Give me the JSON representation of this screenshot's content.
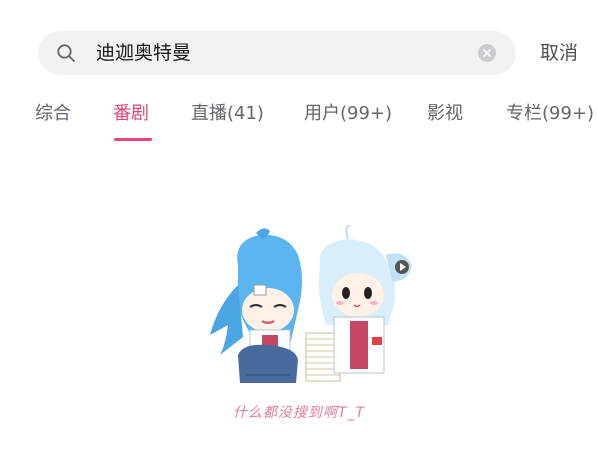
{
  "search": {
    "query": "迪迦奥特曼",
    "cancel_label": "取消"
  },
  "tabs": [
    {
      "label": "综合",
      "active": false
    },
    {
      "label": "番剧",
      "active": true
    },
    {
      "label": "直播(41)",
      "active": false
    },
    {
      "label": "用户(99+)",
      "active": false
    },
    {
      "label": "影视",
      "active": false
    },
    {
      "label": "专栏(99+)",
      "active": false
    }
  ],
  "empty_state": {
    "message": "什么都没搜到啊T_T"
  },
  "colors": {
    "accent": "#e4457f",
    "search_bg": "#f1f2f3",
    "tab_text": "#61666d"
  }
}
